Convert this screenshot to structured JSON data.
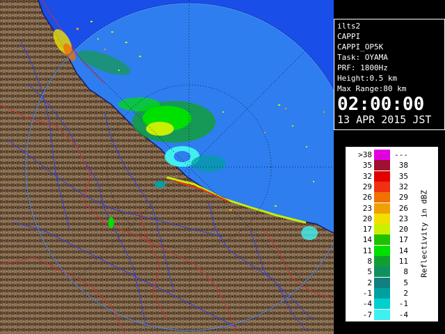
{
  "info": {
    "station": "ilts2",
    "product": "CAPPI",
    "product_id": "CAPPI_OP5K",
    "task": "Task: OYAMA",
    "prf": "PRF: 1800Hz",
    "height": "Height:0.5 km",
    "max_range": "Max Range:80 km",
    "time": "02:00:00",
    "date": "13 APR 2015 JST"
  },
  "legend": {
    "title": "Reflectivity in dBZ",
    "rows": [
      {
        "low": ">38",
        "high": "---",
        "color": "#e000e0"
      },
      {
        "low": "35",
        "high": "38",
        "color": "#a01030"
      },
      {
        "low": "32",
        "high": "35",
        "color": "#e00000"
      },
      {
        "low": "29",
        "high": "32",
        "color": "#f03010"
      },
      {
        "low": "26",
        "high": "29",
        "color": "#f07000"
      },
      {
        "low": "23",
        "high": "26",
        "color": "#f0a000"
      },
      {
        "low": "20",
        "high": "23",
        "color": "#f0e000"
      },
      {
        "low": "17",
        "high": "20",
        "color": "#c8f000"
      },
      {
        "low": "14",
        "high": "17",
        "color": "#20c000"
      },
      {
        "low": "11",
        "high": "14",
        "color": "#00e000"
      },
      {
        "low": "8",
        "high": "11",
        "color": "#10a030"
      },
      {
        "low": "5",
        "high": "8",
        "color": "#109060"
      },
      {
        "low": "2",
        "high": "5",
        "color": "#108080"
      },
      {
        "low": "-1",
        "high": "2",
        "color": "#00a0a0"
      },
      {
        "low": "-4",
        "high": "-1",
        "color": "#00d0d0"
      },
      {
        "low": "-7",
        "high": "-4",
        "color": "#40f0f0"
      }
    ]
  },
  "colors": {
    "sea": "#1a4ee8",
    "coverage": "#2e7ef0",
    "land": "#7a6046",
    "land_dark": "#3a2a1c",
    "rivers": "#3040e0",
    "borders": "#d03030"
  }
}
